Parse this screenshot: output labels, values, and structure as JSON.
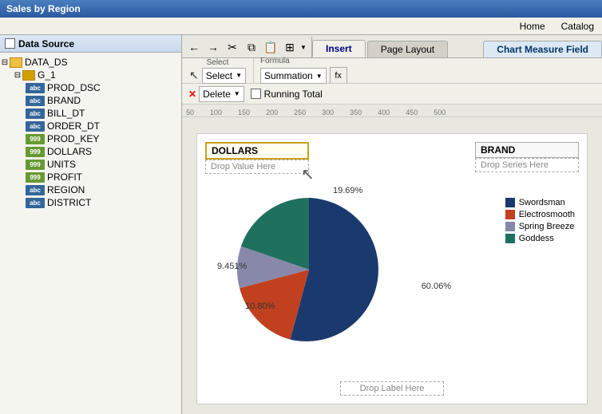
{
  "titleBar": {
    "title": "Sales by Region"
  },
  "menuBar": {
    "items": [
      "Home",
      "Catalog"
    ]
  },
  "leftPanel": {
    "header": "Data Source",
    "tree": {
      "root": "DATA_DS",
      "group": "G_1",
      "fields": [
        {
          "name": "PROD_DSC",
          "type": "abc"
        },
        {
          "name": "BRAND",
          "type": "abc"
        },
        {
          "name": "BILL_DT",
          "type": "abc"
        },
        {
          "name": "ORDER_DT",
          "type": "abc"
        },
        {
          "name": "PROD_KEY",
          "type": "999"
        },
        {
          "name": "DOLLARS",
          "type": "999"
        },
        {
          "name": "UNITS",
          "type": "999"
        },
        {
          "name": "PROFIT",
          "type": "999"
        },
        {
          "name": "REGION",
          "type": "abc"
        },
        {
          "name": "DISTRICT",
          "type": "abc"
        }
      ]
    }
  },
  "tabs": {
    "insert": "Insert",
    "pageLayout": "Page Layout",
    "chartMeasureField": "Chart Measure Field"
  },
  "toolbar": {
    "selectSection": "Select",
    "formulaSection": "Formula",
    "selectLabel": "Select",
    "summationLabel": "Summation",
    "deleteLabel": "Delete",
    "runningTotalLabel": "Running Total"
  },
  "ruler": {
    "ticks": [
      "50",
      "100",
      "150",
      "200",
      "250",
      "300",
      "350",
      "400",
      "450",
      "500"
    ]
  },
  "chart": {
    "dropValueLabel": "DOLLARS",
    "dropValuePlaceholder": "Drop Value Here",
    "dropSeriesLabel": "BRAND",
    "dropSeriesPlaceholder": "Drop Series Here",
    "dropLabelPlaceholder": "Drop Label Here",
    "percentages": {
      "top": "19.69%",
      "left": "9.451%",
      "bottomLeft": "10.80%",
      "right": "60.06%"
    },
    "legend": [
      {
        "name": "Swordsman",
        "color": "#1a3a6e"
      },
      {
        "name": "Electrosmooth",
        "color": "#c04020"
      },
      {
        "name": "Spring Breeze",
        "color": "#8888aa"
      },
      {
        "name": "Goddess",
        "color": "#207060"
      }
    ],
    "pieData": [
      {
        "label": "Swordsman",
        "percent": 60.06,
        "color": "#1a3a6e",
        "startAngle": 0
      },
      {
        "label": "Electrosmooth",
        "percent": 10.8,
        "color": "#c04020"
      },
      {
        "label": "Spring Breeze",
        "percent": 9.451,
        "color": "#8888aa"
      },
      {
        "label": "Goddess",
        "percent": 19.69,
        "color": "#207060"
      }
    ]
  }
}
